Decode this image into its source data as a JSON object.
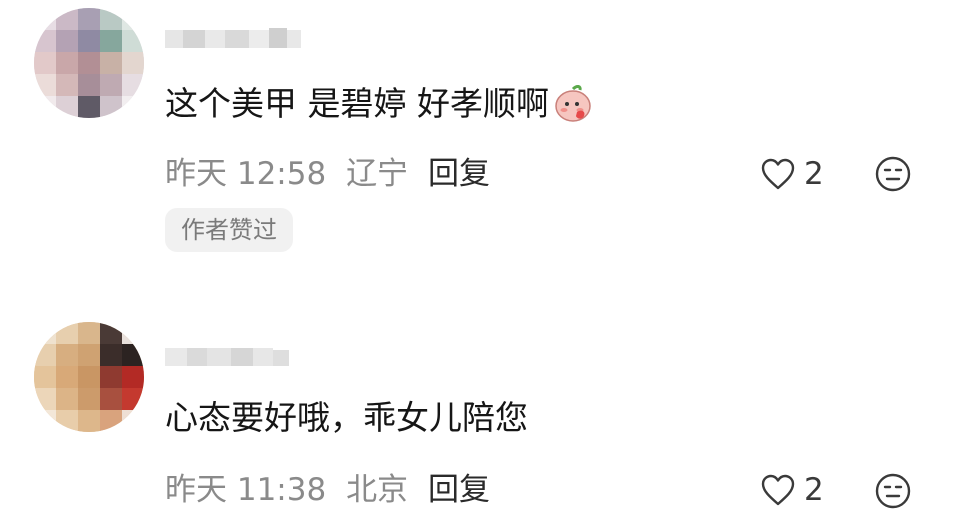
{
  "comments": [
    {
      "text": "这个美甲 是碧婷 好孝顺啊",
      "emoji_icon": "shy-peach-emoji",
      "time": "昨天 12:58",
      "location": "辽宁",
      "reply_label": "回复",
      "like_count": "2",
      "badge": "作者赞过"
    },
    {
      "text": "心态要好哦，乖女儿陪您",
      "time": "昨天 11:38",
      "location": "北京",
      "reply_label": "回复",
      "like_count": "2"
    }
  ],
  "colors": {
    "text": "#161616",
    "meta": "#8a8a8a",
    "badge_bg": "#f1f1f1",
    "badge_text": "#7a7a7a"
  },
  "icons": {
    "like": "heart-outline-icon",
    "dislike": "meh-face-icon"
  }
}
